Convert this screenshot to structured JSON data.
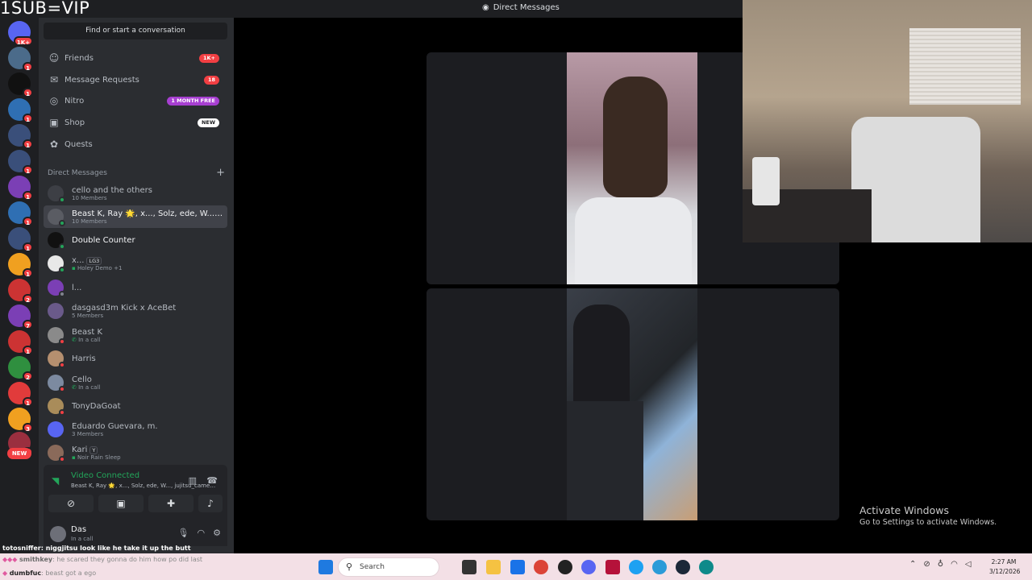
{
  "overlay": {
    "text": "1SUB=VIP"
  },
  "window": {
    "title": "Direct Messages"
  },
  "search": {
    "placeholder": "Find or start a conversation"
  },
  "nav": [
    {
      "label": "Friends",
      "badge": "1K+"
    },
    {
      "label": "Message Requests",
      "badge": "18"
    },
    {
      "label": "Nitro",
      "badge": "1 MONTH FREE"
    },
    {
      "label": "Shop",
      "badge": "NEW"
    },
    {
      "label": "Quests",
      "badge": ""
    }
  ],
  "dm_header": {
    "label": "Direct Messages",
    "add": "+"
  },
  "dms": [
    {
      "name": "cello and the others",
      "sub": "10 Members"
    },
    {
      "name": "Beast K, Ray 🌟, x..., Solz, ede, W..., jujitsu...",
      "sub": "10 Members"
    },
    {
      "name": "Double Counter",
      "sub": ""
    },
    {
      "name": "x...",
      "tag": "LG3",
      "sub": "Holey Demo +1"
    },
    {
      "name": "l...",
      "sub": ""
    },
    {
      "name": "dasgasd3m Kick x AceBet",
      "sub": "5 Members"
    },
    {
      "name": "Beast K",
      "sub": "In a call"
    },
    {
      "name": "Harris",
      "sub": ""
    },
    {
      "name": "Cello",
      "sub": "In a call"
    },
    {
      "name": "TonyDaGoat",
      "sub": ""
    },
    {
      "name": "Eduardo Guevara, m.",
      "sub": "3 Members"
    },
    {
      "name": "Kari",
      "tag": "Y",
      "sub": "Noir Rain Sleep"
    }
  ],
  "servers": {
    "top_badge": "1K+",
    "badges": [
      "1",
      "1",
      "1",
      "1",
      "1",
      "1",
      "1",
      "1",
      "1",
      "2",
      "7",
      "1",
      "2",
      "1",
      "3",
      "1"
    ],
    "new_label": "NEW"
  },
  "voice": {
    "status": "Video Connected",
    "channel": "Beast K, Ray 🌟, x..., Solz, ede, W..., jujitsu_camera..."
  },
  "user": {
    "name": "Das",
    "status": "In a call"
  },
  "chat": {
    "line1_user": "totosniffer",
    "line1_text": ": niggjitsu look like he take it up the butt",
    "line2_user": "smithkey",
    "line2_text": ": he scared they gonna do him how po did last",
    "line3_user": "dumbfuc",
    "line3_text": ": beast got a ego"
  },
  "watermark": {
    "line1": "Activate Windows",
    "line2": "Go to Settings to activate Windows."
  },
  "taskbar": {
    "search_label": "Search",
    "time": "2:27 AM",
    "date": "3/12/2026"
  },
  "colors": {
    "discord_bg": "#2b2d31",
    "rail_bg": "#1e1f22",
    "online": "#23a55a",
    "badge_red": "#f23f43",
    "nitro_purple": "#a73fd1",
    "taskbar": "#f3e0e6"
  }
}
